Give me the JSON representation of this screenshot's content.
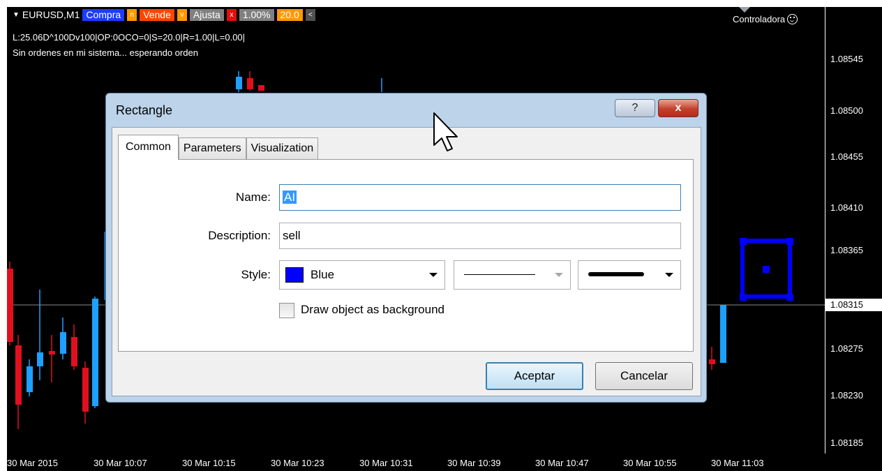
{
  "chart": {
    "symbol": "EURUSD,M1",
    "buttons": [
      {
        "label": "Compra",
        "color": "#1e3cff"
      },
      {
        "label": "n",
        "color": "#ff9900",
        "small": true
      },
      {
        "label": "Vende",
        "color": "#ff4500"
      },
      {
        "label": "v",
        "color": "#ff9900",
        "small": true
      },
      {
        "label": "Ajusta",
        "color": "#808080"
      },
      {
        "label": "x",
        "color": "#e01010",
        "small": true
      },
      {
        "label": "1.00%",
        "color": "#808080"
      },
      {
        "label": "20.0",
        "color": "#ff9900"
      },
      {
        "label": "<",
        "color": "#505050",
        "small": true
      }
    ],
    "info_line1": "L:25.06D^100Dv100|OP:0OCO=0|S=20.0|R=1.00|L=0.00|",
    "info_line2": "Sin ordenes en mi sistema... esperando orden",
    "controller_label": "Controladora",
    "price_labels": [
      "1.08545",
      "1.08500",
      "1.08455",
      "1.08410",
      "1.08365",
      "1.08275",
      "1.08230",
      "1.08185"
    ],
    "current_price": "1.08315",
    "time_labels": [
      "30 Mar 2015",
      "30 Mar 10:07",
      "30 Mar 10:15",
      "30 Mar 10:23",
      "30 Mar 10:31",
      "30 Mar 10:39",
      "30 Mar 10:47",
      "30 Mar 10:55",
      "30 Mar 11:03"
    ],
    "colors": {
      "bull": "#1ea0ff",
      "bear": "#e0101e",
      "object": "#0000ff"
    }
  },
  "dialog": {
    "title": "Rectangle",
    "help_label": "?",
    "close_label": "x",
    "tabs": [
      {
        "label": "Common",
        "active": true
      },
      {
        "label": "Parameters",
        "active": false
      },
      {
        "label": "Visualization",
        "active": false
      }
    ],
    "name_label": "Name:",
    "name_value": "AI",
    "description_label": "Description:",
    "description_value": "sell",
    "style_label": "Style:",
    "color_value": "Blue",
    "color_hex": "#0000ff",
    "background_checkbox_label": "Draw object as background",
    "background_checked": false,
    "ok_label": "Aceptar",
    "cancel_label": "Cancelar"
  }
}
